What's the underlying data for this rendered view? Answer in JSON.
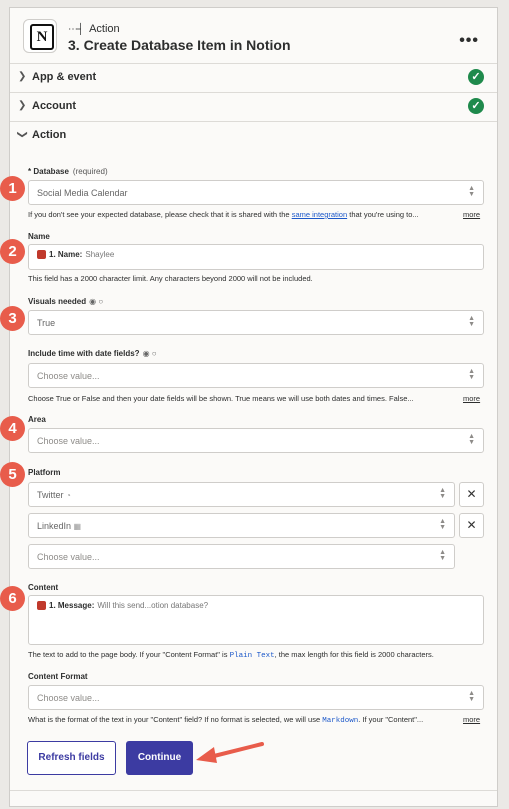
{
  "header": {
    "step_type": "Action",
    "title": "3. Create Database Item in Notion",
    "logo_letter": "N"
  },
  "sections": {
    "app_event": "App & event",
    "account": "Account",
    "action": "Action"
  },
  "markers": [
    "1",
    "2",
    "3",
    "4",
    "5",
    "6"
  ],
  "database": {
    "label": "* Database",
    "required": "(required)",
    "value": "Social Media Calendar",
    "help_pre": "If you don't see your expected database, please check that it is shared with the",
    "help_link": "same integration",
    "help_post": "that you're using to...",
    "more": "more"
  },
  "name": {
    "label": "Name",
    "chip_key": "1. Name:",
    "chip_value": "Shaylee",
    "help": "This field has a 2000 character limit. Any characters beyond 2000 will not be included."
  },
  "visuals": {
    "label": "Visuals needed",
    "value": "True"
  },
  "include_time": {
    "label": "Include time with date fields?",
    "placeholder": "Choose value...",
    "help": "Choose True or False and then your date fields will be shown. True means we will use both dates and times. False...",
    "more": "more"
  },
  "area": {
    "label": "Area",
    "placeholder": "Choose value..."
  },
  "platform": {
    "label": "Platform",
    "values": [
      "Twitter",
      "LinkedIn"
    ],
    "placeholder": "Choose value...",
    "remove": "✕"
  },
  "content": {
    "label": "Content",
    "chip_key": "1. Message:",
    "chip_value": "Will this send...otion database?",
    "help_pre": "The text to add to the page body. If your \"Content Format\" is",
    "help_code": "Plain Text",
    "help_post": ", the max length for this field is 2000 characters."
  },
  "content_format": {
    "label": "Content Format",
    "placeholder": "Choose value...",
    "help_pre": "What is the format of the text in your \"Content\" field? If no format is selected, we will use",
    "help_code": "Markdown",
    "help_post": ". If your \"Content\"...",
    "more": "more"
  },
  "buttons": {
    "refresh": "Refresh fields",
    "continue": "Continue"
  },
  "colors": {
    "accent": "#3c3ba2",
    "marker": "#e85c4b",
    "check": "#1f8a4c"
  }
}
